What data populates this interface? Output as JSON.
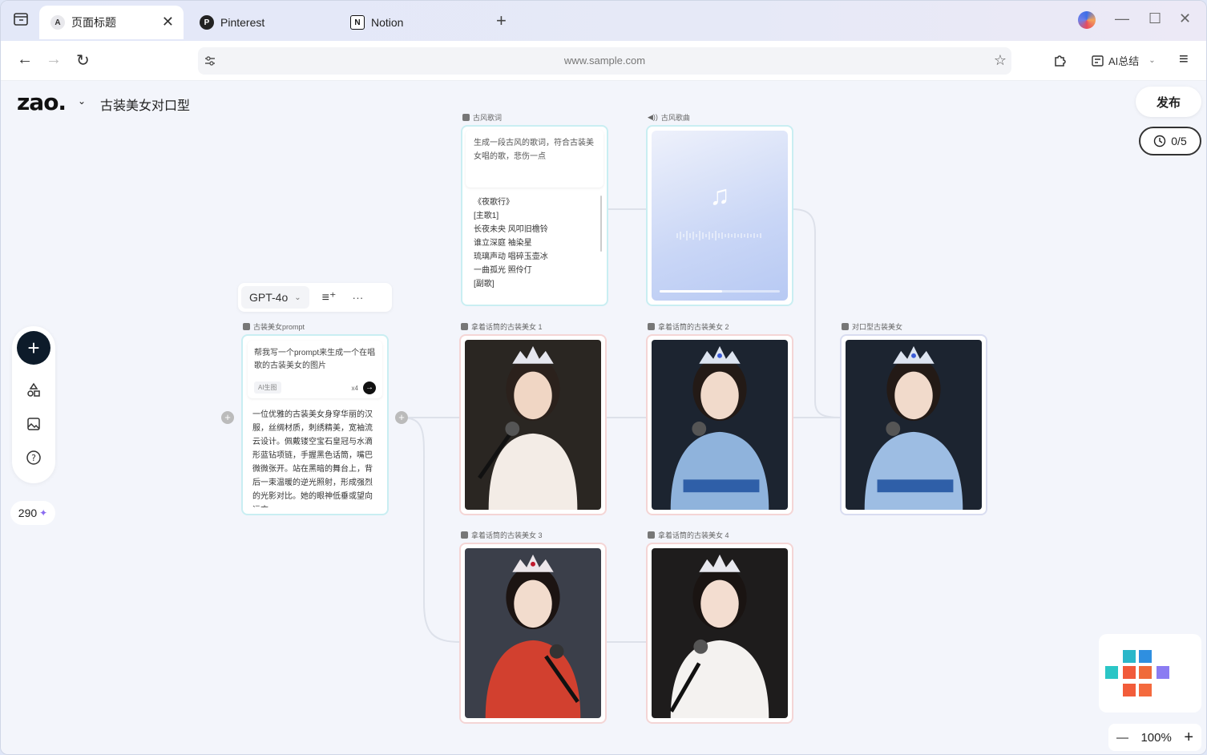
{
  "browser": {
    "tabs": [
      {
        "label": "页面标题",
        "favicon": "A"
      },
      {
        "label": "Pinterest"
      },
      {
        "label": "Notion"
      }
    ],
    "url": "www.sample.com",
    "ai_summary": "AI总结"
  },
  "app": {
    "logo": "zao.",
    "project_title": "古装美女对口型",
    "publish_label": "发布",
    "quota": "0/5",
    "credits": "290",
    "zoom": "100%"
  },
  "model_selector": {
    "label": "GPT-4o"
  },
  "nodes": {
    "prompt": {
      "label": "古装美女prompt",
      "input": "帮我写一个prompt来生成一个在唱歌的古装美女的图片",
      "tool": "AI生图",
      "count": "x4",
      "output": "一位优雅的古装美女身穿华丽的汉服，丝绸材质，刺绣精美，宽袖流云设计。佩戴镂空宝石皇冠与水滴形蓝钻项链，手握黑色话筒，嘴巴微微张开。站在黑暗的舞台上，背后一束温暖的逆光照射，形成强烈的光影对比。她的眼神低垂或望向远方，..."
    },
    "lyrics": {
      "label": "古风歌词",
      "input": "生成一段古风的歌词，符合古装美女唱的歌，悲伤一点",
      "lines": [
        "《夜歌行》",
        "[主歌1]",
        "长夜未央 风叩旧檐铃",
        "谁立深庭 袖染星",
        "琉璃声动 唱碎玉壶冰",
        "一曲孤光 照伶仃",
        "[副歌]",
        "..."
      ]
    },
    "song": {
      "label": "古风歌曲"
    },
    "images": [
      {
        "label": "拿着话筒的古装美女 1",
        "dress": "#f3ece6",
        "bg": "#2a2622"
      },
      {
        "label": "拿着话筒的古装美女 2",
        "dress": "#8fb3dc",
        "bg": "#1c2430"
      },
      {
        "label": "拿着话筒的古装美女 3",
        "dress": "#d2402f",
        "bg": "#3b3f4a"
      },
      {
        "label": "拿着话筒的古装美女 4",
        "dress": "#f4f2f0",
        "bg": "#1e1c1c"
      }
    ],
    "lipsync": {
      "label": "对口型古装美女",
      "dress": "#9dbde3",
      "bg": "#1c2430"
    }
  },
  "colors": {
    "accent": "#0d1b2a",
    "cyan_border": "#c9eef2",
    "pink_border": "#f4d5d5"
  },
  "icons": [
    "browser-panel-icon",
    "pinterest-icon",
    "notion-icon",
    "back-icon",
    "forward-icon",
    "reload-icon",
    "site-settings-icon",
    "star-icon",
    "extension-icon",
    "ai-summary-icon",
    "menu-icon",
    "shapes-icon",
    "gallery-icon",
    "help-icon",
    "sparkle-icon",
    "history-icon",
    "music-note-icon"
  ]
}
